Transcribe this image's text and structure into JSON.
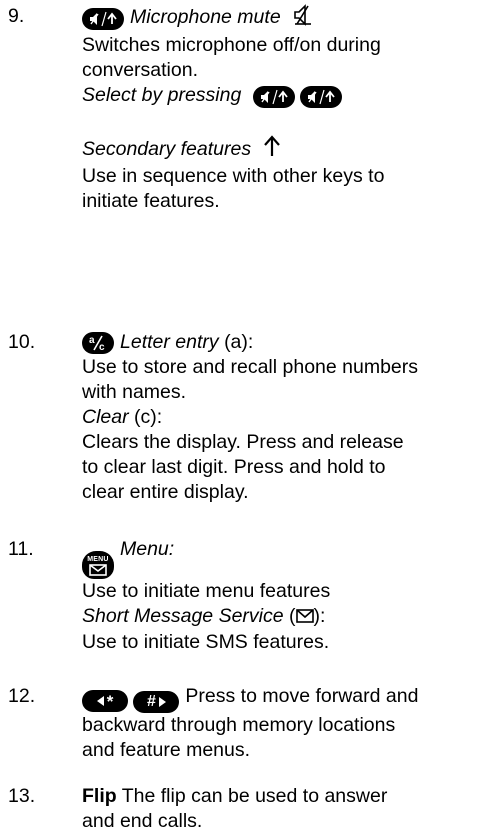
{
  "items": [
    {
      "number": "9.",
      "title": "Microphone mute",
      "lines": {
        "desc1": "Switches microphone off/on during",
        "desc2": "conversation.",
        "select": "Select by pressing",
        "secondary": "Secondary features",
        "seq1": "Use in sequence with other keys to",
        "seq2": "initiate features."
      }
    },
    {
      "number": "10.",
      "title": "Letter entry",
      "title_suffix": "(a):",
      "lines": {
        "desc1": "Use to store and recall phone numbers",
        "desc2": "with names.",
        "clear_title": "Clear",
        "clear_suffix": "(c):",
        "clear1": "Clears the display.  Press and release",
        "clear2": "to clear last digit.  Press and hold to",
        "clear3": "clear entire display."
      }
    },
    {
      "number": "11.",
      "title": "Menu:",
      "menu_key_text": "MENU",
      "lines": {
        "desc1": "Use to initiate menu features",
        "sms_title": "Short Message Service",
        "sms_paren_open": "(",
        "sms_paren_close": "):",
        "sms_desc": "Use to initiate SMS features."
      }
    },
    {
      "number": "12.",
      "key_star": "*",
      "key_hash": "#",
      "lines": {
        "desc1": "Press to move forward and",
        "desc2": "backward through memory locations",
        "desc3": "and feature menus."
      }
    },
    {
      "number": "13.",
      "title": "Flip",
      "lines": {
        "desc1": "The flip can be used to answer",
        "desc2": "and end calls."
      }
    }
  ],
  "icons": {
    "mute_key": "mute-arrow-key-icon",
    "mute_symbol": "microphone-muted-icon",
    "secondary_arrow": "up-arrow-icon",
    "letter_key": "letter-clear-key-icon",
    "menu_key": "menu-envelope-key-icon",
    "envelope": "envelope-icon",
    "left_key": "left-star-key-icon",
    "right_key": "hash-right-key-icon"
  }
}
